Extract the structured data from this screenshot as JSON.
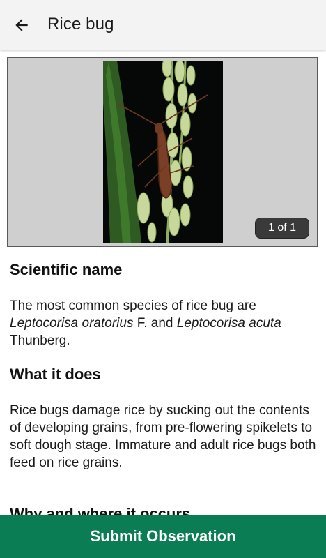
{
  "header": {
    "back_icon": "arrow-left-icon",
    "title": "Rice bug"
  },
  "gallery": {
    "counter": "1 of 1"
  },
  "sections": {
    "scientific": {
      "heading": "Scientific name",
      "text_1": "The most common species of rice bug are ",
      "species_1": "Leptocorisa oratorius",
      "text_2": " F. and ",
      "species_2": "Leptocorisa acuta",
      "text_3": " Thunberg."
    },
    "what_it_does": {
      "heading": "What it does",
      "body": "Rice bugs damage rice by sucking out the contents of developing grains, from pre-flowering spikelets to soft dough stage. Immature and adult rice bugs both feed on rice grains."
    },
    "why_important": {
      "heading": "Why and where it occurs"
    }
  },
  "footer": {
    "submit_label": "Submit Observation",
    "accent_color": "#0b7d55"
  }
}
